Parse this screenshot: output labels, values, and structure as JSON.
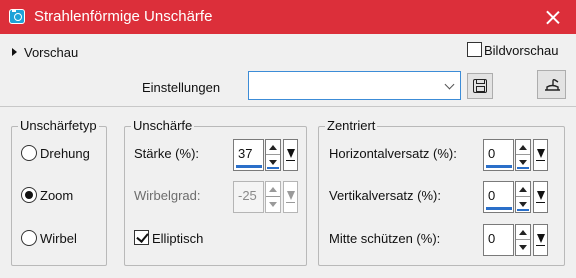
{
  "window": {
    "title": "Strahlenförmige Unschärfe"
  },
  "preview": {
    "label": "Vorschau",
    "bildvorschau_label": "Bildvorschau",
    "bildvorschau_checked": false
  },
  "presets": {
    "label": "Einstellungen",
    "value": ""
  },
  "group_type": {
    "legend": "Unschärfetyp",
    "options": [
      {
        "label": "Drehung",
        "selected": false
      },
      {
        "label": "Zoom",
        "selected": true
      },
      {
        "label": "Wirbel",
        "selected": false
      }
    ]
  },
  "group_blur": {
    "legend": "Unschärfe",
    "staerke": {
      "label": "Stärke (%):",
      "value": "37"
    },
    "wirbelgrad": {
      "label": "Wirbelgrad:",
      "value": "-25",
      "disabled": true
    },
    "elliptisch": {
      "label": "Elliptisch",
      "checked": true
    }
  },
  "group_center": {
    "legend": "Zentriert",
    "horizontal": {
      "label": "Horizontalversatz (%):",
      "value": "0"
    },
    "vertikal": {
      "label": "Vertikalversatz (%):",
      "value": "0"
    },
    "mitte": {
      "label": "Mitte schützen (%):",
      "value": "0"
    }
  },
  "colors": {
    "titlebar": "#dc2f3a",
    "accent": "#2a6fc9",
    "background": "#f0f0f0"
  }
}
